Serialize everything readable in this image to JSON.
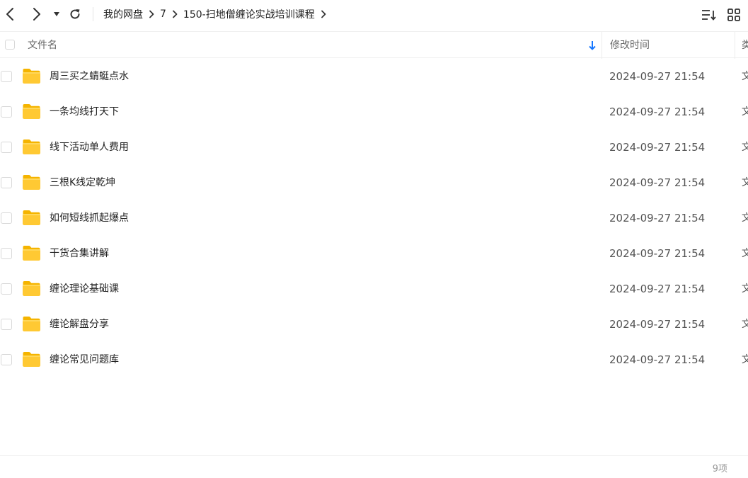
{
  "toolbar": {
    "back_icon": "chevron-left-icon",
    "forward_icon": "chevron-right-icon",
    "history_icon": "caret-down-icon",
    "refresh_icon": "refresh-icon",
    "breadcrumb": [
      "我的网盘",
      "7",
      "150-扫地僧缠论实战培训课程"
    ],
    "sort_icon": "sort-list-icon",
    "view_icon": "grid-view-icon"
  },
  "table": {
    "headers": {
      "name": "文件名",
      "time": "修改时间",
      "type": "类型"
    },
    "rows": [
      {
        "name": "周三买之蜻蜓点水",
        "time": "2024-09-27 21:54",
        "type": "文件夹"
      },
      {
        "name": "一条均线打天下",
        "time": "2024-09-27 21:54",
        "type": "文件夹"
      },
      {
        "name": "线下活动单人费用",
        "time": "2024-09-27 21:54",
        "type": "文件夹"
      },
      {
        "name": "三根K线定乾坤",
        "time": "2024-09-27 21:54",
        "type": "文件夹"
      },
      {
        "name": "如何短线抓起爆点",
        "time": "2024-09-27 21:54",
        "type": "文件夹"
      },
      {
        "name": "干货合集讲解",
        "time": "2024-09-27 21:54",
        "type": "文件夹"
      },
      {
        "name": "缠论理论基础课",
        "time": "2024-09-27 21:54",
        "type": "文件夹"
      },
      {
        "name": "缠论解盘分享",
        "time": "2024-09-27 21:54",
        "type": "文件夹"
      },
      {
        "name": "缠论常见问题库",
        "time": "2024-09-27 21:54",
        "type": "文件夹"
      }
    ]
  },
  "footer": {
    "count": "9项"
  },
  "colors": {
    "folder": "#FFC933",
    "folder_dark": "#F5B400",
    "sort_arrow": "#1677ff"
  }
}
